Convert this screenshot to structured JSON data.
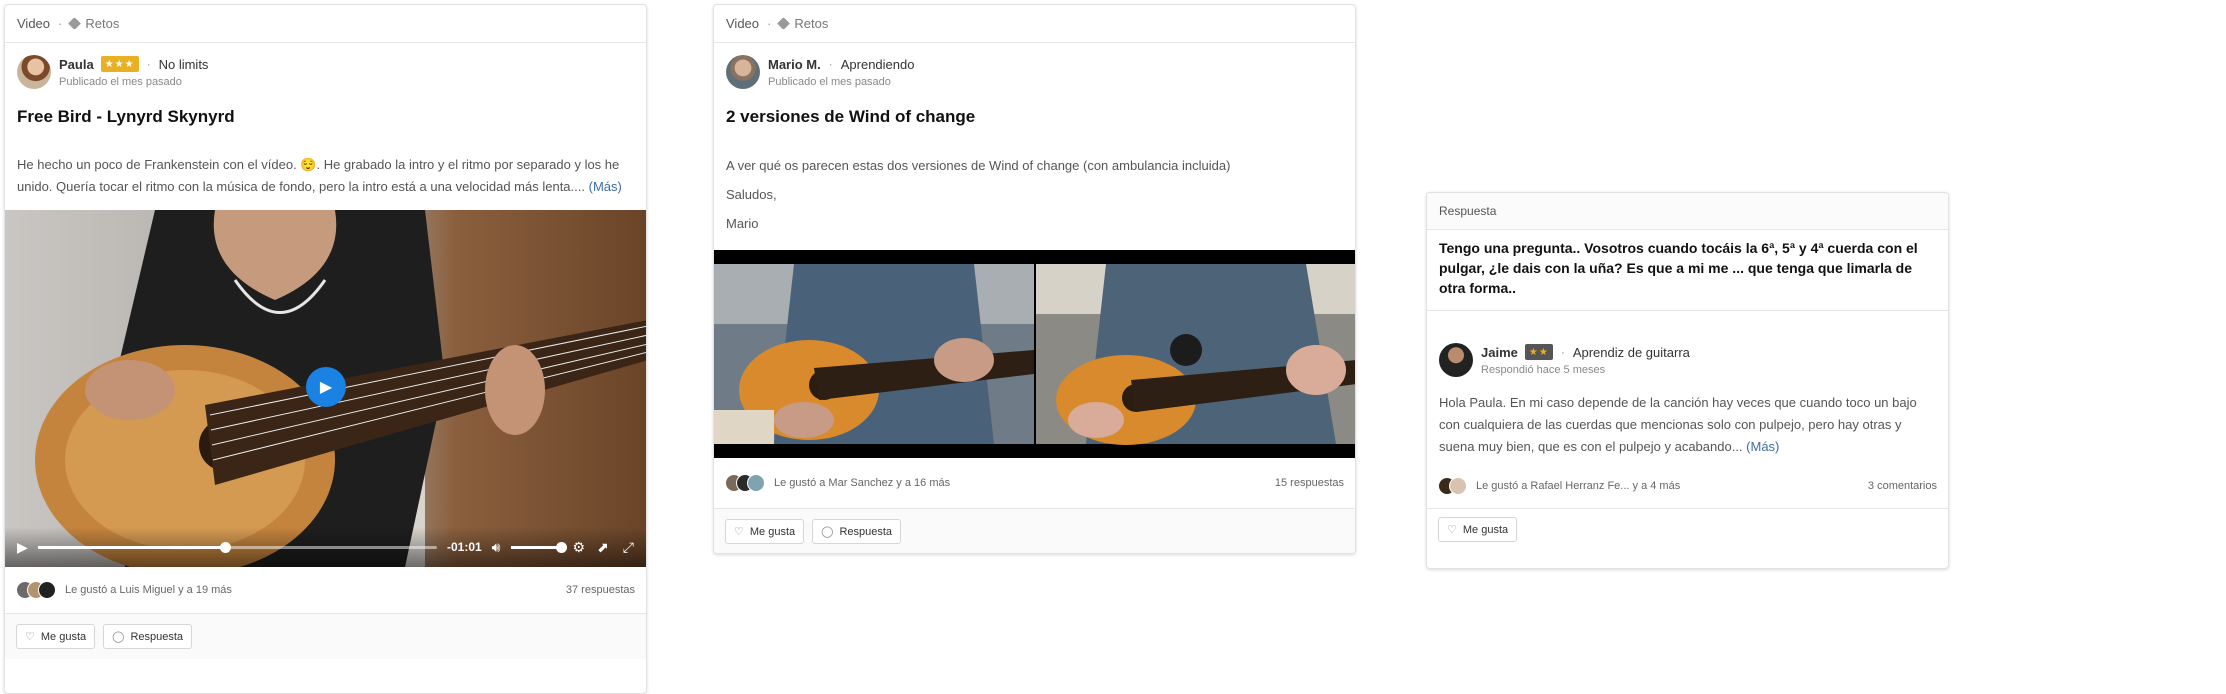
{
  "card1": {
    "crumb": {
      "section": "Video",
      "tag": "Retos"
    },
    "author": {
      "name": "Paula",
      "badge": "★★★",
      "rank": "No limits",
      "posted": "Publicado el mes pasado"
    },
    "title": "Free Bird - Lynyrd Skynyrd",
    "body": "He hecho un poco de Frankenstein con el vídeo. 😌. He grabado la intro y el ritmo por separado y los he unido. Quería tocar el ritmo con la música de fondo, pero la intro está a una velocidad más lenta....",
    "more": "(Más)",
    "video": {
      "time": "-01:01",
      "progress": 0.47
    },
    "likes": "Le gustó a Luis Miguel y a 19 más",
    "replies": "37 respuestas",
    "like_btn": "Me gusta",
    "reply_btn": "Respuesta"
  },
  "card2": {
    "crumb": {
      "section": "Video",
      "tag": "Retos"
    },
    "author": {
      "name": "Mario M.",
      "rank": "Aprendiendo",
      "posted": "Publicado el mes pasado"
    },
    "title": "2 versiones de Wind of change",
    "body_lines": [
      "A ver qué os parecen estas dos versiones de Wind of change (con ambulancia incluida)",
      "Saludos,",
      "Mario"
    ],
    "likes": "Le gustó a Mar Sanchez y a 16 más",
    "replies": "15 respuestas",
    "like_btn": "Me gusta",
    "reply_btn": "Respuesta"
  },
  "card3": {
    "header": "Respuesta",
    "question": "Tengo una pregunta.. Vosotros cuando tocáis la 6ª, 5ª y 4ª cuerda con el pulgar, ¿le dais con la uña? Es que a mi me ... que tenga que limarla de otra forma..",
    "author": {
      "name": "Jaime",
      "badge": "★★",
      "rank": "Aprendiz de guitarra",
      "posted": "Respondió hace 5 meses"
    },
    "body": "Hola Paula. En mi caso depende de la canción hay veces que cuando toco un bajo con cualquiera de las cuerdas que mencionas solo con pulpejo, pero hay otras y suena muy bien, que es con el pulpejo y acabando...",
    "more": "(Más)",
    "likes": "Le gustó a Rafael Herranz Fe... y a 4 más",
    "comments": "3 comentarios",
    "like_btn": "Me gusta"
  },
  "icons": {
    "tag": "tag-icon",
    "heart": "heart-icon",
    "comment": "comment-icon",
    "play": "play-icon"
  }
}
